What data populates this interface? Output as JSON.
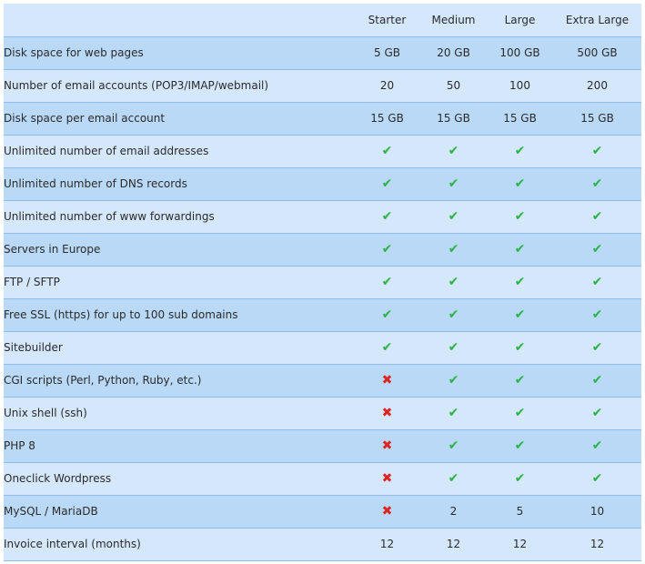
{
  "table": {
    "plans": [
      "Starter",
      "Medium",
      "Large",
      "Extra Large"
    ],
    "rows": [
      {
        "label": "Disk space for web pages",
        "values": [
          "5 GB",
          "20 GB",
          "100 GB",
          "500 GB"
        ]
      },
      {
        "label": "Number of email accounts (POP3/IMAP/webmail)",
        "values": [
          "20",
          "50",
          "100",
          "200"
        ]
      },
      {
        "label": "Disk space per email account",
        "values": [
          "15 GB",
          "15 GB",
          "15 GB",
          "15 GB"
        ]
      },
      {
        "label": "Unlimited number of email addresses",
        "values": [
          "yes",
          "yes",
          "yes",
          "yes"
        ]
      },
      {
        "label": "Unlimited number of DNS records",
        "values": [
          "yes",
          "yes",
          "yes",
          "yes"
        ]
      },
      {
        "label": "Unlimited number of www forwardings",
        "values": [
          "yes",
          "yes",
          "yes",
          "yes"
        ]
      },
      {
        "label": "Servers in Europe",
        "values": [
          "yes",
          "yes",
          "yes",
          "yes"
        ]
      },
      {
        "label": "FTP / SFTP",
        "values": [
          "yes",
          "yes",
          "yes",
          "yes"
        ]
      },
      {
        "label": "Free SSL (https) for up to 100 sub domains",
        "values": [
          "yes",
          "yes",
          "yes",
          "yes"
        ]
      },
      {
        "label": "Sitebuilder",
        "values": [
          "yes",
          "yes",
          "yes",
          "yes"
        ]
      },
      {
        "label": "CGI scripts (Perl, Python, Ruby, etc.)",
        "values": [
          "no",
          "yes",
          "yes",
          "yes"
        ]
      },
      {
        "label": "Unix shell (ssh)",
        "values": [
          "no",
          "yes",
          "yes",
          "yes"
        ]
      },
      {
        "label": "PHP 8",
        "values": [
          "no",
          "yes",
          "yes",
          "yes"
        ]
      },
      {
        "label": "Oneclick Wordpress",
        "values": [
          "no",
          "yes",
          "yes",
          "yes"
        ]
      },
      {
        "label": "MySQL / MariaDB",
        "values": [
          "no",
          "2",
          "5",
          "10"
        ]
      },
      {
        "label": "Invoice interval (months)",
        "values": [
          "12",
          "12",
          "12",
          "12"
        ]
      }
    ]
  },
  "icons": {
    "yes": "check-icon",
    "no": "cross-icon"
  },
  "colors": {
    "check": "#2db24a",
    "cross": "#e02424",
    "row_dark": "#b9d9f7",
    "row_light": "#d4e7fb",
    "border": "#8fbde6"
  }
}
